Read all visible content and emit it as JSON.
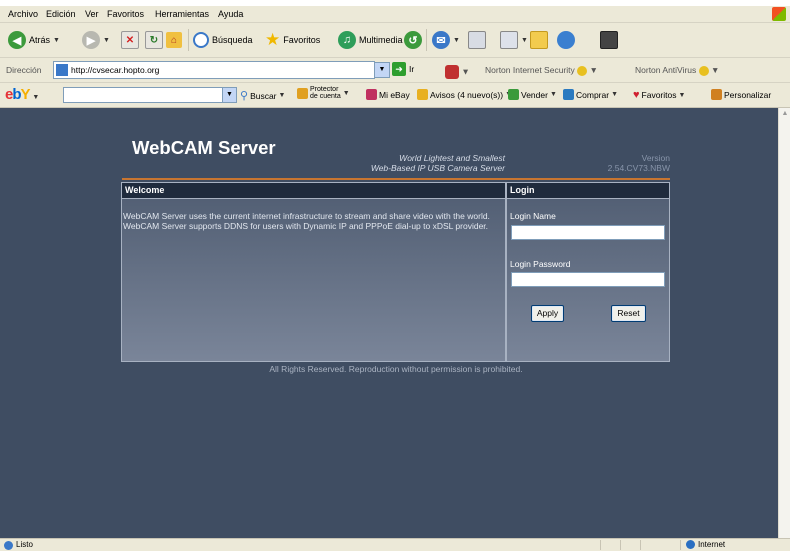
{
  "menu": [
    "Archivo",
    "Edición",
    "Ver",
    "Favoritos",
    "Herramientas",
    "Ayuda"
  ],
  "toolbar": {
    "back": "Atrás",
    "search": "Búsqueda",
    "favorites": "Favoritos",
    "multimedia": "Multimedia"
  },
  "address": {
    "label": "Dirección",
    "url": "http://cvsecar.hopto.org",
    "go": "Ir",
    "norton_security": "Norton Internet Security",
    "norton_antivirus": "Norton AntiVirus"
  },
  "ebay": {
    "search": "Buscar",
    "protector_line1": "Protector",
    "protector_line2": "de cuenta",
    "my_ebay": "Mi eBay",
    "alerts": "Avisos (4 nuevo(s))",
    "sell": "Vender",
    "buy": "Comprar",
    "favorites": "Favoritos",
    "customize": "Personalizar"
  },
  "page": {
    "title": "WebCAM Server",
    "tagline_1": "World Lightest and Smallest",
    "tagline_2": "Web-Based IP USB Camera Server",
    "version_label": "Version",
    "version": "2.54.CV73.NBW",
    "welcome_header": "Welcome",
    "welcome_p1": "WebCAM Server uses the current internet infrastructure to stream and share video with the world.",
    "welcome_p2": "WebCAM Server supports DDNS for users with Dynamic IP and PPPoE dial-up to xDSL provider.",
    "login_header": "Login",
    "login_name_label": "Login Name",
    "login_password_label": "Login Password",
    "apply": "Apply",
    "reset": "Reset",
    "footer": "All Rights Reserved. Reproduction without permission is prohibited."
  },
  "status": {
    "text": "Listo",
    "zone": "Internet"
  }
}
